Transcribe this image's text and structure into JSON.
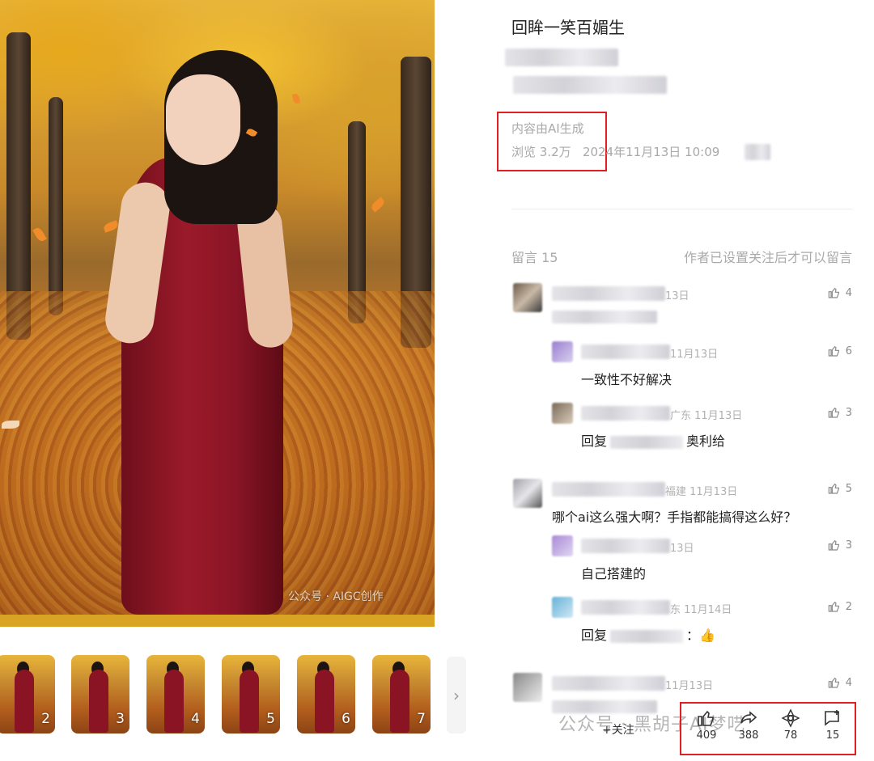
{
  "post": {
    "title": "回眸一笑百媚生",
    "ai_label": "内容由AI生成",
    "views": "浏览 3.2万",
    "timestamp": "2024年11月13日 10:09"
  },
  "comments_header": {
    "label": "留言 15",
    "note": "作者已设置关注后才可以留言"
  },
  "comments": [
    {
      "meta": "13日",
      "text": "",
      "likes": "4",
      "level": 1
    },
    {
      "meta": "11月13日",
      "text": "一致性不好解决",
      "likes": "6",
      "level": 2
    },
    {
      "meta": "广东 11月13日",
      "text": "回复",
      "text_suffix": "奥利给",
      "likes": "3",
      "level": 2
    },
    {
      "meta": "福建 11月13日",
      "text": "哪个ai这么强大啊？手指都能搞得这么好？",
      "likes": "5",
      "level": 1
    },
    {
      "meta": "13日",
      "text": "自己搭建的",
      "likes": "3",
      "level": 2
    },
    {
      "meta": "东 11月14日",
      "text": "回复",
      "text_suffix": "：👍",
      "likes": "2",
      "level": 2
    },
    {
      "meta": "11月13日",
      "text": "",
      "likes": "4",
      "level": 1
    }
  ],
  "thumbnails": [
    "2",
    "3",
    "4",
    "5",
    "6",
    "7"
  ],
  "actions": {
    "like": "409",
    "share": "388",
    "recommend": "78",
    "comment": "15",
    "follow": "+关注"
  },
  "watermarks": {
    "photo": "公众号 · AIGC创作",
    "page": "公众号 · 黑胡子AI梦呓"
  },
  "colors": {
    "highlight_box": "#e02020",
    "dress": "#9b1a2a",
    "meta_gray": "#a9a9a9"
  }
}
